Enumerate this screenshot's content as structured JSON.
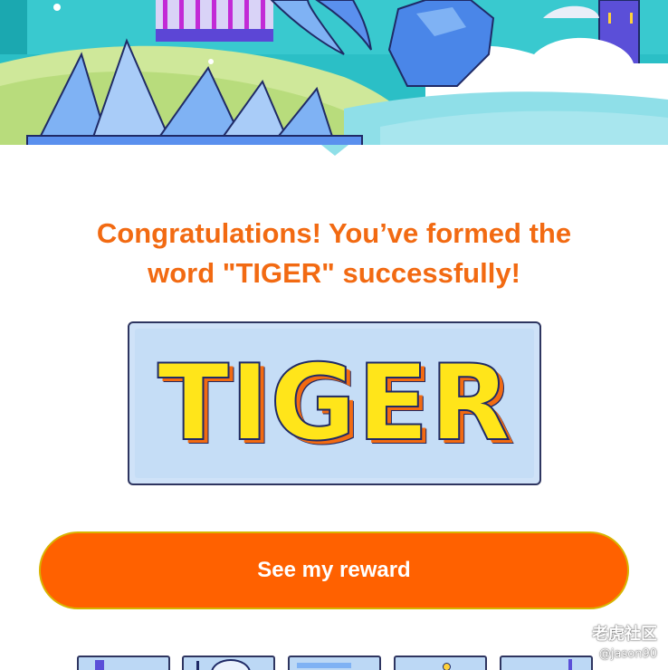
{
  "message": {
    "line1": "Congratulations! You’ve formed the",
    "line2": "word \"TIGER\" successfully!"
  },
  "word_card": {
    "word": "TIGER"
  },
  "reward_button": {
    "label": "See my reward"
  },
  "watermark": {
    "site": "老虎社区",
    "user": "@jason90"
  },
  "colors": {
    "accent_orange": "#ff6100",
    "text_orange": "#f26a12",
    "card_blue": "#c5ddf6",
    "letter_yellow": "#ffe51a",
    "outline_navy": "#1f2a66"
  },
  "icons": {
    "watermark_logo": "tiger-community-logo-icon"
  }
}
